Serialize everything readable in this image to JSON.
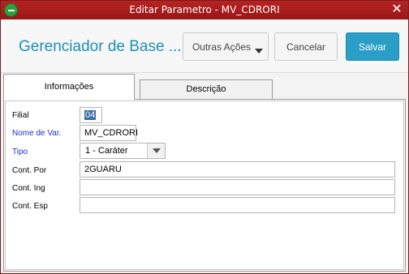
{
  "window": {
    "title": "Editar Parametro - MV_CDRORI",
    "close_glyph": "✕"
  },
  "header": {
    "app_title": "Gerenciador de Base ...",
    "buttons": {
      "outras": "Outras Ações",
      "cancelar": "Cancelar",
      "salvar": "Salvar"
    }
  },
  "tabs": [
    {
      "label": "Informações",
      "active": true
    },
    {
      "label": "Descrição",
      "active": false
    }
  ],
  "form": {
    "filial": {
      "label": "Filial",
      "value": "04"
    },
    "nome_var": {
      "label": "Nome de Var.",
      "value": "MV_CDRORI"
    },
    "tipo": {
      "label": "Tipo",
      "value": "1 - Caráter"
    },
    "cont_por": {
      "label": "Cont. Por",
      "value": "2GUARU"
    },
    "cont_ing": {
      "label": "Cont. Ing",
      "value": ""
    },
    "cont_esp": {
      "label": "Cont. Esp",
      "value": ""
    }
  },
  "colors": {
    "titlebar": "#b62323",
    "accent": "#2b9ec7",
    "app_title": "#1f8fb4",
    "required_label": "#1f2fcf"
  }
}
